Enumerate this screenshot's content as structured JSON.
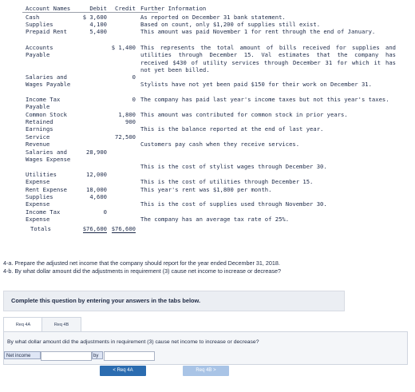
{
  "table": {
    "headers": {
      "account": "Account Names",
      "debit": "Debit",
      "credit": "Credit",
      "info": "Further Information"
    },
    "rows": [
      {
        "account": "Cash",
        "debit": "$ 3,600",
        "credit": "",
        "info": "As reported on December 31 bank statement."
      },
      {
        "account": "Supplies",
        "debit": "4,100",
        "credit": "",
        "info": "Based on count, only $1,200 of supplies still exist."
      },
      {
        "account": "Prepaid Rent",
        "debit": "5,400",
        "credit": "",
        "info": "This amount was paid November 1 for rent through the end of January."
      },
      {
        "account": "Accounts Payable",
        "debit": "",
        "credit": "$ 1,400",
        "info": "This represents the total amount of bills received for supplies and utilities through December 15. Val estimates that the company has received $430 of utility services through December 31 for which it has not yet been billed."
      },
      {
        "account": "Salaries and Wages Payable",
        "debit": "",
        "credit": "0",
        "info": "Stylists have not yet been paid $150 for their work on December 31."
      },
      {
        "account": "Income Tax Payable",
        "debit": "",
        "credit": "0",
        "info": "The company has paid last year's income taxes but not this year's taxes."
      },
      {
        "account": "Common Stock",
        "debit": "",
        "credit": "1,800",
        "info": "This amount was contributed for common stock in prior years."
      },
      {
        "account": "Retained Earnings",
        "debit": "",
        "credit": "900",
        "info": "This is the balance reported at the end of last year."
      },
      {
        "account": "Service Revenue",
        "debit": "",
        "credit": "72,500",
        "info": "Customers pay cash when they receive services."
      },
      {
        "account": "Salaries and Wages Expense",
        "debit": "28,900",
        "credit": "",
        "info": "This is the cost of stylist wages through December 30."
      },
      {
        "account": "Utilities Expense",
        "debit": "12,000",
        "credit": "",
        "info": "This is the cost of utilities through December 15."
      },
      {
        "account": "Rent Expense",
        "debit": "18,000",
        "credit": "",
        "info": "This year's rent was $1,800 per month."
      },
      {
        "account": "Supplies Expense",
        "debit": "4,600",
        "credit": "",
        "info": "This is the cost of supplies used through November 30."
      },
      {
        "account": "Income Tax Expense",
        "debit": "0",
        "credit": "",
        "info": "The company has an average tax rate of 25%."
      },
      {
        "account": "Totals",
        "debit": "$76,600",
        "credit": "$76,600",
        "info": ""
      }
    ]
  },
  "requirements": {
    "a": "4-a. Prepare the adjusted net income that the company should report for the year ended December 31, 2018.",
    "b": "4-b. By what dollar amount did the adjustments in requirement (3) cause net income to increase or decrease?"
  },
  "instruction": "Complete this question by entering your answers in the tabs below.",
  "tabs": [
    "Req 4A",
    "Req 4B"
  ],
  "question": "By what dollar amount did the adjustments in requirement (3) cause net income to increase or decrease?",
  "answer_row": {
    "label": "Net income",
    "by_label": "by",
    "select_value": "",
    "input_value": ""
  },
  "nav": {
    "prev": "< Req 4A",
    "next": "Req 4B >"
  }
}
